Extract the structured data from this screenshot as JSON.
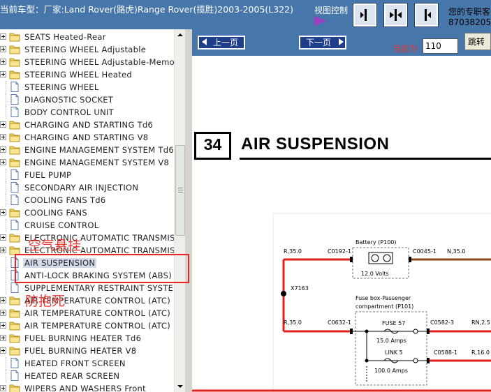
{
  "header": {
    "car_model": "当前车型：厂家:Land Rover(路虎)Range Rover(揽胜)2003-2005(L322)",
    "view_control_label": "视图控制",
    "view_buttons": [
      "expand-right",
      "split-view",
      "collapse-left"
    ],
    "contact_line1": "您的专职客",
    "contact_line2": "87038205"
  },
  "tree": {
    "items": [
      {
        "label": "SEATS Heated-Rear",
        "type": "folder"
      },
      {
        "label": "STEERING WHEEL Adjustable",
        "type": "folder"
      },
      {
        "label": "STEERING WHEEL Adjustable-Memory",
        "type": "folder"
      },
      {
        "label": "STEERING WHEEL Heated",
        "type": "folder"
      },
      {
        "label": "STEERING WHEEL",
        "type": "page"
      },
      {
        "label": "DIAGNOSTIC SOCKET",
        "type": "page"
      },
      {
        "label": "BODY CONTROL UNIT",
        "type": "page"
      },
      {
        "label": "CHARGING AND STARTING Td6",
        "type": "folder"
      },
      {
        "label": "CHARGING AND STARTING V8",
        "type": "folder"
      },
      {
        "label": "ENGINE MANAGEMENT SYSTEM Td6",
        "type": "folder"
      },
      {
        "label": "ENGINE MANAGEMENT SYSTEM V8",
        "type": "folder"
      },
      {
        "label": "FUEL PUMP",
        "type": "page"
      },
      {
        "label": "SECONDARY AIR INJECTION",
        "type": "page"
      },
      {
        "label": "COOLING FANS Td6",
        "type": "page"
      },
      {
        "label": "COOLING FANS",
        "type": "folder"
      },
      {
        "label": "CRUISE CONTROL",
        "type": "page"
      },
      {
        "label": "ELECTRONIC AUTOMATIC TRANSMIS",
        "type": "folder"
      },
      {
        "label": "ELECTRONIC AUTOMATIC TRANSMIS",
        "type": "folder"
      },
      {
        "label": "AIR SUSPENSION",
        "type": "page",
        "selected": true
      },
      {
        "label": "ANTI-LOCK BRAKING SYSTEM (ABS)",
        "type": "page"
      },
      {
        "label": "SUPPLEMENTARY RESTRAINT SYSTEM",
        "type": "page"
      },
      {
        "label": "AIR TEMPERATURE CONTROL (ATC) I",
        "type": "folder"
      },
      {
        "label": "AIR TEMPERATURE CONTROL (ATC) I",
        "type": "folder"
      },
      {
        "label": "AIR TEMPERATURE CONTROL (ATC) F",
        "type": "folder"
      },
      {
        "label": "FUEL BURNING HEATER Td6",
        "type": "folder"
      },
      {
        "label": "FUEL BURNING HEATER V8",
        "type": "folder"
      },
      {
        "label": "HEATED FRONT SCREEN",
        "type": "page"
      },
      {
        "label": "HEATED REAR SCREEN",
        "type": "page"
      },
      {
        "label": "WIPERS AND WASHERS Front",
        "type": "folder"
      }
    ]
  },
  "annotations": {
    "air_suspension_cn": "空气悬挂",
    "abs_cn": "防抱死",
    "highlight_color": "#e8242a"
  },
  "doc_toolbar": {
    "prev_label": "上一页",
    "next_label": "下一页",
    "current_label": "当前为",
    "current_page": "110",
    "jump_label": "跳转"
  },
  "document": {
    "section_number": "34",
    "section_title": "AIR SUSPENSION",
    "diagram": {
      "battery_label": "Battery (P100)",
      "battery_volts": "12.0 Volts",
      "wire_r35_top": "R,35.0",
      "conn_c0192": "C0192-1",
      "conn_c0045": "C0045-1",
      "wire_n35": "N,35.0",
      "splice_x7163": "X7163",
      "fusebox_label_1": "Fuse box-Passenger",
      "fusebox_label_2": "compartment (P101)",
      "wire_r35_bottom": "R,35.0",
      "conn_c0632": "C0632-1",
      "fuse57_label": "FUSE 57",
      "fuse57_amps": "15.0 Amps",
      "conn_c0582": "C0582-3",
      "wire_rn25": "RN,2.5",
      "link5_label": "LINK 5",
      "link5_amps": "100.0 Amps",
      "conn_c0588": "C0588-1",
      "wire_r16": "R,16.0"
    }
  },
  "colors": {
    "header_bg": "#4777aa",
    "wire_red": "#e0201c",
    "wire_brown": "#8b4a1e"
  }
}
